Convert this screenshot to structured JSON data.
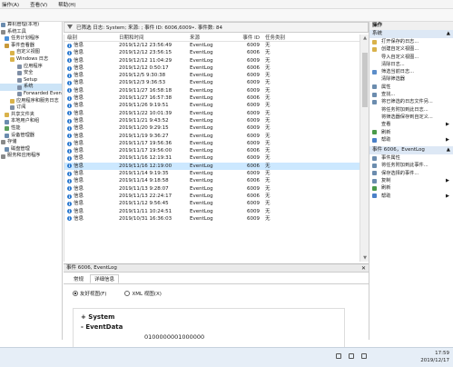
{
  "menubar": {
    "items": [
      "操作(A)",
      "查看(V)",
      "帮助(H)"
    ]
  },
  "tree": {
    "items": [
      {
        "label": "算机管理(本地)",
        "indent": 0,
        "selected": false,
        "color": "#6b8cae"
      },
      {
        "label": "系统工具",
        "indent": 0,
        "selected": false,
        "color": "#8a8a8a"
      },
      {
        "label": "任务计划程序",
        "indent": 4,
        "selected": false,
        "color": "#4a90d9"
      },
      {
        "label": "事件查看器",
        "indent": 4,
        "selected": false,
        "color": "#c89a3a"
      },
      {
        "label": "自定义视图",
        "indent": 10,
        "selected": false,
        "color": "#d9b24a"
      },
      {
        "label": "Windows 日志",
        "indent": 10,
        "selected": false,
        "color": "#d9b24a"
      },
      {
        "label": "应用程序",
        "indent": 18,
        "selected": false,
        "color": "#7f8fa6"
      },
      {
        "label": "安全",
        "indent": 18,
        "selected": false,
        "color": "#7f8fa6"
      },
      {
        "label": "Setup",
        "indent": 18,
        "selected": false,
        "color": "#7f8fa6"
      },
      {
        "label": "系统",
        "indent": 18,
        "selected": true,
        "color": "#7f8fa6"
      },
      {
        "label": "Forwarded Even",
        "indent": 18,
        "selected": false,
        "color": "#7f8fa6"
      },
      {
        "label": "应用程序和服务日志",
        "indent": 10,
        "selected": false,
        "color": "#d9b24a"
      },
      {
        "label": "订阅",
        "indent": 10,
        "selected": false,
        "color": "#7f8fa6"
      },
      {
        "label": "共享文件夹",
        "indent": 4,
        "selected": false,
        "color": "#d9b24a"
      },
      {
        "label": "本地用户和组",
        "indent": 4,
        "selected": false,
        "color": "#6b8cae"
      },
      {
        "label": "性能",
        "indent": 4,
        "selected": false,
        "color": "#5aa05a"
      },
      {
        "label": "设备管理器",
        "indent": 4,
        "selected": false,
        "color": "#6b8cae"
      },
      {
        "label": "存储",
        "indent": 0,
        "selected": false,
        "color": "#8a8a8a"
      },
      {
        "label": "磁盘管理",
        "indent": 4,
        "selected": false,
        "color": "#6b8cae"
      },
      {
        "label": "服务和应用程序",
        "indent": 0,
        "selected": false,
        "color": "#8a8a8a"
      }
    ]
  },
  "filter": {
    "text": "已筛选 日志: System; 来源: ; 事件 ID: 6006,6009•. 事件数: 84"
  },
  "grid": {
    "headers": [
      "级别",
      "日期和时间",
      "来源",
      "事件 ID",
      "任务类别"
    ],
    "rows": [
      {
        "level": "信息",
        "date": "2019/12/12 23:56:49",
        "source": "EventLog",
        "id": "6009",
        "cat": "无",
        "selected": false
      },
      {
        "level": "信息",
        "date": "2019/12/12 23:56:15",
        "source": "EventLog",
        "id": "6006",
        "cat": "无",
        "selected": false
      },
      {
        "level": "信息",
        "date": "2019/12/12 11:04:29",
        "source": "EventLog",
        "id": "6009",
        "cat": "无",
        "selected": false
      },
      {
        "level": "信息",
        "date": "2019/12/12 0:50:17",
        "source": "EventLog",
        "id": "6006",
        "cat": "无",
        "selected": false
      },
      {
        "level": "信息",
        "date": "2019/12/5 9:30:38",
        "source": "EventLog",
        "id": "6009",
        "cat": "无",
        "selected": false
      },
      {
        "level": "信息",
        "date": "2019/12/3 9:36:53",
        "source": "EventLog",
        "id": "6009",
        "cat": "无",
        "selected": false
      },
      {
        "level": "信息",
        "date": "2019/11/27 16:58:18",
        "source": "EventLog",
        "id": "6009",
        "cat": "无",
        "selected": false
      },
      {
        "level": "信息",
        "date": "2019/11/27 16:57:38",
        "source": "EventLog",
        "id": "6006",
        "cat": "无",
        "selected": false
      },
      {
        "level": "信息",
        "date": "2019/11/26 9:19:51",
        "source": "EventLog",
        "id": "6009",
        "cat": "无",
        "selected": false
      },
      {
        "level": "信息",
        "date": "2019/11/22 10:01:39",
        "source": "EventLog",
        "id": "6009",
        "cat": "无",
        "selected": false
      },
      {
        "level": "信息",
        "date": "2019/11/21 9:43:52",
        "source": "EventLog",
        "id": "6009",
        "cat": "无",
        "selected": false
      },
      {
        "level": "信息",
        "date": "2019/11/20 9:29:15",
        "source": "EventLog",
        "id": "6009",
        "cat": "无",
        "selected": false
      },
      {
        "level": "信息",
        "date": "2019/11/19 9:36:27",
        "source": "EventLog",
        "id": "6009",
        "cat": "无",
        "selected": false
      },
      {
        "level": "信息",
        "date": "2019/11/17 19:56:36",
        "source": "EventLog",
        "id": "6009",
        "cat": "无",
        "selected": false
      },
      {
        "level": "信息",
        "date": "2019/11/17 19:56:00",
        "source": "EventLog",
        "id": "6006",
        "cat": "无",
        "selected": false
      },
      {
        "level": "信息",
        "date": "2019/11/16 12:19:31",
        "source": "EventLog",
        "id": "6009",
        "cat": "无",
        "selected": false
      },
      {
        "level": "信息",
        "date": "2019/11/16 12:19:00",
        "source": "EventLog",
        "id": "6006",
        "cat": "无",
        "selected": true
      },
      {
        "level": "信息",
        "date": "2019/11/14 9:19:35",
        "source": "EventLog",
        "id": "6009",
        "cat": "无",
        "selected": false
      },
      {
        "level": "信息",
        "date": "2019/11/14 9:18:58",
        "source": "EventLog",
        "id": "6006",
        "cat": "无",
        "selected": false
      },
      {
        "level": "信息",
        "date": "2019/11/13 9:28:07",
        "source": "EventLog",
        "id": "6009",
        "cat": "无",
        "selected": false
      },
      {
        "level": "信息",
        "date": "2019/11/13 22:24:17",
        "source": "EventLog",
        "id": "6006",
        "cat": "无",
        "selected": false
      },
      {
        "level": "信息",
        "date": "2019/11/12 9:56:45",
        "source": "EventLog",
        "id": "6009",
        "cat": "无",
        "selected": false
      },
      {
        "level": "信息",
        "date": "2019/11/11 10:24:51",
        "source": "EventLog",
        "id": "6009",
        "cat": "无",
        "selected": false
      },
      {
        "level": "信息",
        "date": "2019/10/31 16:36:03",
        "source": "EventLog",
        "id": "6009",
        "cat": "无",
        "selected": false
      }
    ]
  },
  "detail": {
    "title": "事件 6006, EventLog",
    "tabs": [
      "常规",
      "详细信息"
    ],
    "radio_friendly": "友好视图(F)",
    "radio_xml": "XML 视图(X)",
    "xml_system": "+  System",
    "xml_eventdata": "-  EventData",
    "xml_value": "0100000001000000"
  },
  "actions": {
    "header": "操作",
    "section1": "系统",
    "items1": [
      {
        "label": "打开保存的日志...",
        "color": "#d9b24a",
        "arrow": false
      },
      {
        "label": "创建自定义视图...",
        "color": "#d9b24a",
        "arrow": false
      },
      {
        "label": "导入自定义视图...",
        "color": "#ffffff",
        "arrow": false
      },
      {
        "label": "清除日志...",
        "color": "#ffffff",
        "arrow": false
      },
      {
        "label": "筛选当前日志...",
        "color": "#5b8dc9",
        "arrow": false
      },
      {
        "label": "清除筛选器",
        "color": "#ffffff",
        "arrow": false
      },
      {
        "label": "属性",
        "color": "#6b8cae",
        "arrow": false
      },
      {
        "label": "查找...",
        "color": "#6b8cae",
        "arrow": false
      },
      {
        "label": "将已筛选的日志文件另...",
        "color": "#6b8cae",
        "arrow": false
      },
      {
        "label": "将任务附加到此日志...",
        "color": "#ffffff",
        "arrow": false
      },
      {
        "label": "将筛选器保存到自定义...",
        "color": "#ffffff",
        "arrow": false
      },
      {
        "label": "查看",
        "color": "#ffffff",
        "arrow": true
      },
      {
        "label": "刷新",
        "color": "#4a9a4a",
        "arrow": false
      },
      {
        "label": "帮助",
        "color": "#4a80c8",
        "arrow": true
      }
    ],
    "section2": "事件 6006，EventLog",
    "items2": [
      {
        "label": "事件属性",
        "color": "#6b8cae",
        "arrow": false
      },
      {
        "label": "将任务附加到此事件...",
        "color": "#6b8cae",
        "arrow": false
      },
      {
        "label": "保存选择的事件...",
        "color": "#6b8cae",
        "arrow": false
      },
      {
        "label": "复制",
        "color": "#6b8cae",
        "arrow": true
      },
      {
        "label": "刷新",
        "color": "#4a9a4a",
        "arrow": false
      },
      {
        "label": "帮助",
        "color": "#4a80c8",
        "arrow": true
      }
    ]
  },
  "taskbar": {
    "time": "17:59",
    "date": "2019/12/17"
  }
}
